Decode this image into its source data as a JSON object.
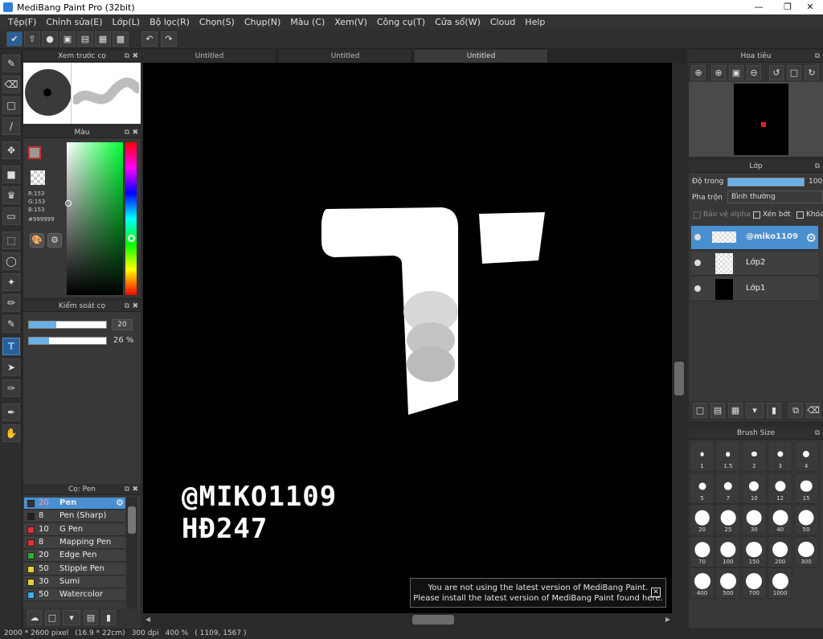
{
  "window": {
    "title": "MediBang Paint Pro (32bit)"
  },
  "menu": [
    "Tệp(F)",
    "Chỉnh sửa(E)",
    "Lớp(L)",
    "Bộ lọc(R)",
    "Chọn(S)",
    "Chụp(N)",
    "Màu (C)",
    "Xem(V)",
    "Công cụ(T)",
    "Cửa sổ(W)",
    "Cloud",
    "Help"
  ],
  "tabs": [
    "Untitled",
    "Untitled",
    "Untitled"
  ],
  "panels": {
    "brush_preview": "Xem trước cọ",
    "color": "Màu",
    "brush_control": "Kiểm soát cọ",
    "brush_list": "Cọ: Pen",
    "navigator": "Hoa tiêu",
    "layer": "Lớp",
    "brush_size": "Brush Size"
  },
  "color": {
    "r": "R:153",
    "g": "G:153",
    "b": "B:153",
    "hex": "#999999",
    "current": "#999999"
  },
  "brush_control": {
    "size": "20",
    "opacity": "26 %",
    "size_fraction": 0.35,
    "opacity_fraction": 0.26
  },
  "brushes": [
    {
      "size": "20",
      "name": "Pen",
      "color": "#333333",
      "selected": true
    },
    {
      "size": "8",
      "name": "Pen (Sharp)",
      "color": "#222222"
    },
    {
      "size": "10",
      "name": "G Pen",
      "color": "#e03030"
    },
    {
      "size": "8",
      "name": "Mapping Pen",
      "color": "#e03030"
    },
    {
      "size": "20",
      "name": "Edge Pen",
      "color": "#30b030"
    },
    {
      "size": "50",
      "name": "Stipple Pen",
      "color": "#e6d030"
    },
    {
      "size": "30",
      "name": "Sumi",
      "color": "#e6d030"
    },
    {
      "size": "50",
      "name": "Watercolor",
      "color": "#40b0e8"
    }
  ],
  "layer_panel": {
    "opacity_label": "Độ trong",
    "opacity_value": "100",
    "blend_label": "Pha trộn",
    "blend_value": "Bình thường",
    "protect_alpha": "Bảo vệ alpha",
    "clipping": "Xén bớt",
    "lock": "Khóa",
    "layers": [
      {
        "name": "@miko1109",
        "selected": true
      },
      {
        "name": "Lớp2"
      },
      {
        "name": "Lớp1"
      }
    ]
  },
  "brush_sizes": [
    "1",
    "1.5",
    "2",
    "3",
    "4",
    "5",
    "7",
    "10",
    "12",
    "15",
    "20",
    "25",
    "30",
    "40",
    "50",
    "70",
    "100",
    "150",
    "200",
    "300",
    "400",
    "500",
    "700",
    "1000"
  ],
  "canvas": {
    "signature_line1": "@MIKO1109",
    "signature_line2": "HĐ247"
  },
  "notice": {
    "line1": "You are not using the latest version of MediBang Paint.",
    "line2": "Please install the latest version of MediBang Paint found here."
  },
  "status": {
    "size_px": "2000 * 2600 pixel",
    "size_cm": "(16.9 * 22cm)",
    "dpi": "300 dpi",
    "zoom": "400 %",
    "coords": "( 1109, 1567 )"
  }
}
